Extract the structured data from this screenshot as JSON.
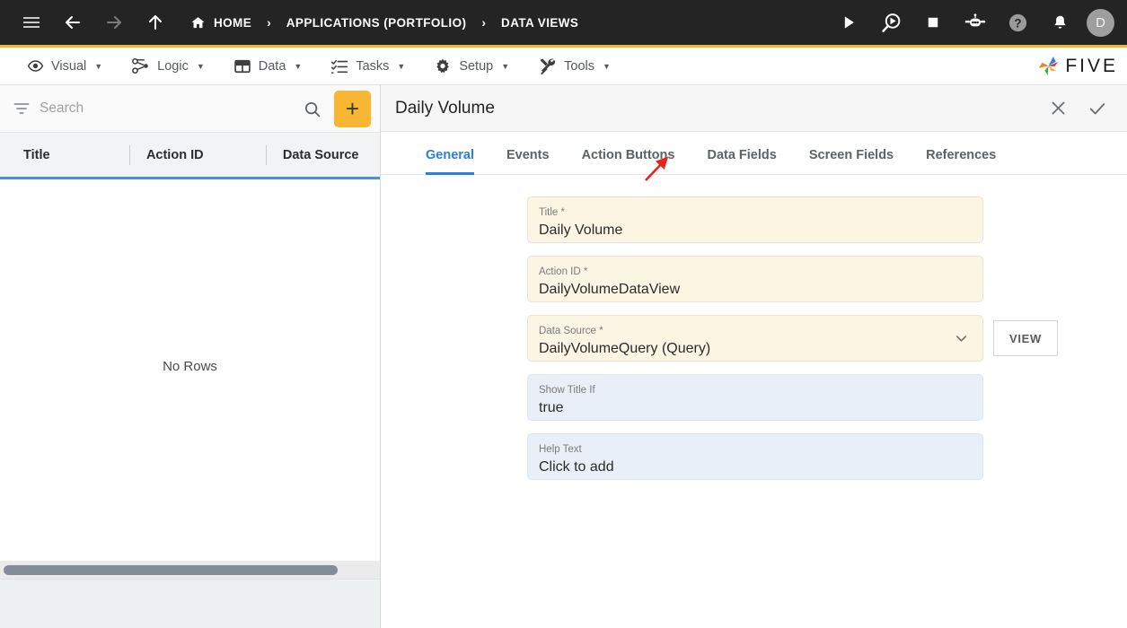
{
  "topbar": {
    "nav_icons": [
      {
        "name": "hamburger-menu-icon",
        "label": "Menu"
      },
      {
        "name": "back-arrow-icon",
        "label": "Back"
      },
      {
        "name": "forward-arrow-icon",
        "label": "Forward"
      },
      {
        "name": "up-arrow-icon",
        "label": "Up"
      }
    ],
    "breadcrumbs": [
      {
        "label": "HOME",
        "icon": "home-icon"
      },
      {
        "label": "APPLICATIONS (PORTFOLIO)",
        "icon": ""
      },
      {
        "label": "DATA VIEWS",
        "icon": ""
      }
    ],
    "separator": "›",
    "right_icons": [
      {
        "name": "run-play-icon",
        "label": "Run"
      },
      {
        "name": "debug-icon",
        "label": "Debug"
      },
      {
        "name": "stop-icon",
        "label": "Stop"
      },
      {
        "name": "robot-icon",
        "label": "Assistant"
      },
      {
        "name": "help-icon",
        "label": "Help"
      },
      {
        "name": "notifications-bell-icon",
        "label": "Notifications"
      }
    ],
    "avatar_initial": "D",
    "accent_color": "#f5b731",
    "background_color": "#242424"
  },
  "menubar": {
    "items": [
      {
        "label": "Visual",
        "icon": "eye-icon",
        "caret": "▼"
      },
      {
        "label": "Logic",
        "icon": "logic-nodes-icon",
        "caret": "▼"
      },
      {
        "label": "Data",
        "icon": "table-grid-icon",
        "caret": "▼"
      },
      {
        "label": "Tasks",
        "icon": "checklist-icon",
        "caret": "▼"
      },
      {
        "label": "Setup",
        "icon": "gear-icon",
        "caret": "▼"
      },
      {
        "label": "Tools",
        "icon": "tools-icon",
        "caret": "▼"
      }
    ],
    "brand": "FIVE"
  },
  "sidebar": {
    "search": {
      "placeholder": "Search",
      "value": "",
      "filter_icon": "filter-icon",
      "search_icon": "search-icon"
    },
    "add_button_label": "+",
    "table": {
      "columns": [
        "Title",
        "Action ID",
        "Data Source"
      ],
      "rows": [],
      "empty_message": "No Rows",
      "header_underline_color": "#4a90d9"
    }
  },
  "panel": {
    "title": "Daily Volume",
    "close_icon": "close-icon",
    "confirm_icon": "check-icon",
    "tabs": [
      {
        "label": "General",
        "active": true
      },
      {
        "label": "Events",
        "active": false
      },
      {
        "label": "Action Buttons",
        "active": false
      },
      {
        "label": "Data Fields",
        "active": false
      },
      {
        "label": "Screen Fields",
        "active": false
      },
      {
        "label": "References",
        "active": false
      }
    ],
    "active_tab_color": "#2b7de0",
    "fields": [
      {
        "label": "Title *",
        "value": "Daily Volume",
        "required": true,
        "type": "text",
        "name": "title-field"
      },
      {
        "label": "Action ID *",
        "value": "DailyVolumeDataView",
        "required": true,
        "type": "text",
        "name": "action-id-field"
      },
      {
        "label": "Data Source *",
        "value": "DailyVolumeQuery (Query)",
        "required": true,
        "type": "select",
        "name": "data-source-field",
        "button_label": "VIEW"
      },
      {
        "label": "Show Title If",
        "value": "true",
        "required": false,
        "type": "text",
        "name": "show-title-if-field"
      },
      {
        "label": "Help Text",
        "value": "Click to add",
        "required": false,
        "type": "text",
        "name": "help-text-field"
      }
    ]
  },
  "annotation": {
    "arrow_color": "#e8231f",
    "points_to": "Data Fields"
  }
}
